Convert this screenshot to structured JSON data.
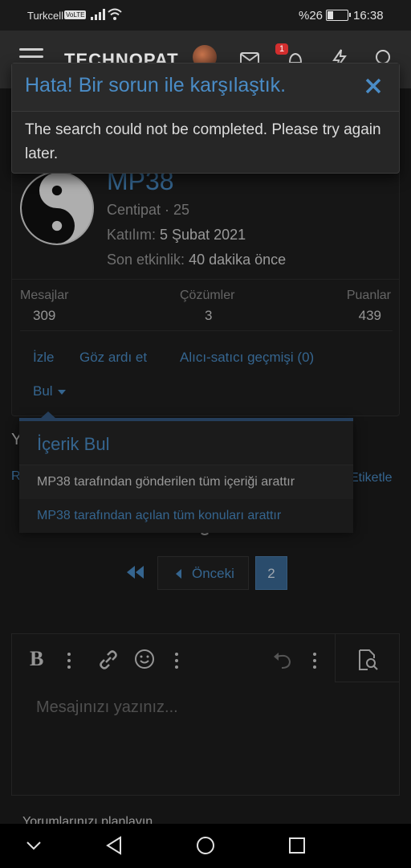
{
  "status_bar": {
    "carrier": "Turkcell",
    "volte": "VoLTE",
    "battery": "%26",
    "time": "16:38"
  },
  "top_nav": {
    "logo": "TECHNOPAT",
    "notification_count": "1"
  },
  "error_dialog": {
    "title": "Hata! Bir sorun ile karşılaştık.",
    "message": "The search could not be completed. Please try again later."
  },
  "profile": {
    "username": "MP38",
    "rank": "Centipat · 25",
    "joined_label": "Katılım:",
    "joined_value": "5 Şubat 2021",
    "last_seen_label": "Son etkinlik:",
    "last_seen_value": "40 dakika önce",
    "stats": [
      {
        "label": "Mesajlar",
        "value": "309"
      },
      {
        "label": "Çözümler",
        "value": "3"
      },
      {
        "label": "Puanlar",
        "value": "439"
      }
    ],
    "links": {
      "follow": "İzle",
      "ignore": "Göz ardı et",
      "trade_history": "Alıcı-satıcı geçmişi (0)",
      "find": "Bul"
    }
  },
  "find_menu": {
    "title": "İçerik Bul",
    "items": [
      "MP38 tarafından gönderilen tüm içeriği arattır",
      "MP38 tarafından açılan tüm konuları arattır"
    ]
  },
  "background": {
    "y_text": "Y",
    "r_text": "R",
    "etiketle": "Etiketle"
  },
  "pagination": {
    "prev_label": "Önceki",
    "current_page": "2"
  },
  "editor": {
    "bold": "B",
    "placeholder": "Mesajınızı yazınız..."
  },
  "bottom_partial": "Yorumlarınızı planlayın"
}
